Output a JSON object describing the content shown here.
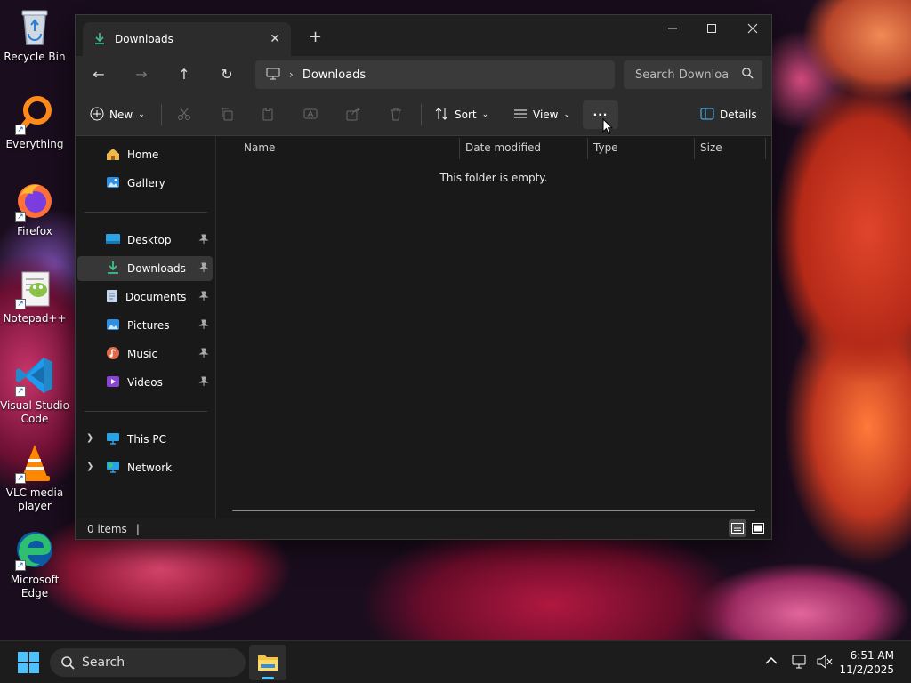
{
  "desktop": {
    "icons": [
      {
        "label": "Recycle Bin",
        "icon": "recycle-bin-icon"
      },
      {
        "label": "Everything",
        "icon": "everything-search-icon"
      },
      {
        "label": "Firefox",
        "icon": "firefox-icon"
      },
      {
        "label": "Notepad++",
        "icon": "notepadpp-icon"
      },
      {
        "label": "Visual Studio Code",
        "icon": "vscode-icon"
      },
      {
        "label": "VLC media player",
        "icon": "vlc-icon"
      },
      {
        "label": "Microsoft Edge",
        "icon": "edge-icon"
      }
    ]
  },
  "window": {
    "tab_title": "Downloads",
    "breadcrumb": {
      "separator": "›",
      "current": "Downloads"
    },
    "search_placeholder": "Search Downloa",
    "toolbar": {
      "new_label": "New",
      "sort_label": "Sort",
      "view_label": "View",
      "more_label": "···",
      "details_label": "Details"
    },
    "nav": {
      "quick": [
        {
          "label": "Home"
        },
        {
          "label": "Gallery"
        }
      ],
      "pinned": [
        {
          "label": "Desktop",
          "pinned": true
        },
        {
          "label": "Downloads",
          "pinned": true,
          "selected": true
        },
        {
          "label": "Documents",
          "pinned": true
        },
        {
          "label": "Pictures",
          "pinned": true
        },
        {
          "label": "Music",
          "pinned": true
        },
        {
          "label": "Videos",
          "pinned": true
        }
      ],
      "drives": [
        {
          "label": "This PC"
        },
        {
          "label": "Network"
        }
      ]
    },
    "columns": [
      "Name",
      "Date modified",
      "Type",
      "Size"
    ],
    "empty_message": "This folder is empty.",
    "status": {
      "items": "0 items",
      "separator": "|"
    }
  },
  "taskbar": {
    "search_label": "Search",
    "time": "6:51 AM",
    "date": "11/2/2025"
  },
  "colors": {
    "accent": "#4cc2ff",
    "window_bg": "#191919",
    "toolbar_bg": "#2c2c2c",
    "folder_yellow": "#f5c542",
    "downloads_green": "#3fc28a"
  }
}
